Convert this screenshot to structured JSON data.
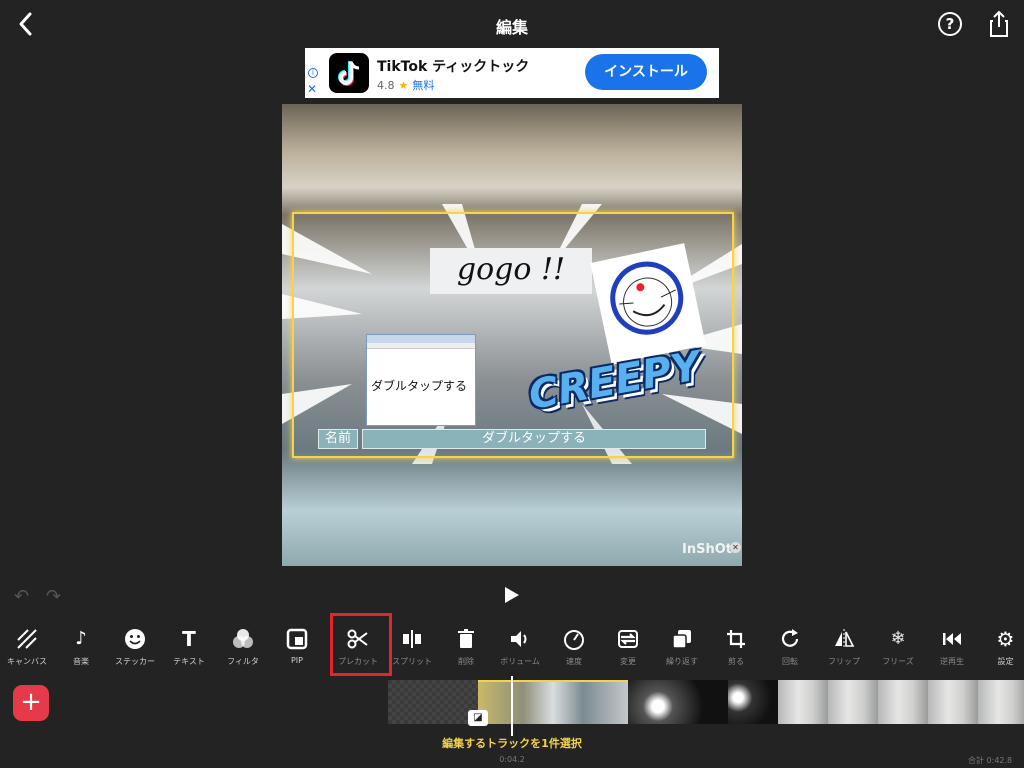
{
  "header": {
    "title": "編集",
    "help_label": "?"
  },
  "ad": {
    "app_name": "TikTok ティックトック",
    "rating": "4.8",
    "price": "無料",
    "install_label": "インストール",
    "close_label": "✕",
    "info_label": "i"
  },
  "preview": {
    "gogo_text": "gogo !!",
    "notepad_text": "ダブルタップする",
    "sticker_text": "CREEPY",
    "name_box": "名前",
    "dialog_box": "ダブルタップする",
    "watermark": "InShOt",
    "accent": "#f6d44a"
  },
  "toolbar": {
    "tools": [
      {
        "label": "キャンバス",
        "icon": "canvas-icon"
      },
      {
        "label": "音楽",
        "icon": "music-note-icon"
      },
      {
        "label": "ステッカー",
        "icon": "smiley-icon"
      },
      {
        "label": "テキスト",
        "icon": "text-icon"
      },
      {
        "label": "フィルタ",
        "icon": "filter-icon"
      },
      {
        "label": "PIP",
        "icon": "pip-icon"
      },
      {
        "label": "プレカット",
        "icon": "scissors-icon"
      },
      {
        "label": "スプリット",
        "icon": "split-icon"
      },
      {
        "label": "削除",
        "icon": "trash-icon"
      },
      {
        "label": "ボリューム",
        "icon": "volume-icon"
      },
      {
        "label": "速度",
        "icon": "speed-icon"
      },
      {
        "label": "変更",
        "icon": "replace-icon"
      },
      {
        "label": "繰り返す",
        "icon": "duplicate-icon"
      },
      {
        "label": "剪る",
        "icon": "crop-icon"
      },
      {
        "label": "回転",
        "icon": "rotate-icon"
      },
      {
        "label": "フリップ",
        "icon": "flip-icon"
      },
      {
        "label": "フリーズ",
        "icon": "freeze-icon"
      },
      {
        "label": "逆再生",
        "icon": "reverse-icon"
      },
      {
        "label": "設定",
        "icon": "gear-icon"
      }
    ],
    "highlight_color": "#e3262b"
  },
  "timeline": {
    "hint": "編集するトラックを1件選択",
    "current_time": "0:04.2",
    "total_time": "合計 0:42.8",
    "add_label": "+"
  }
}
